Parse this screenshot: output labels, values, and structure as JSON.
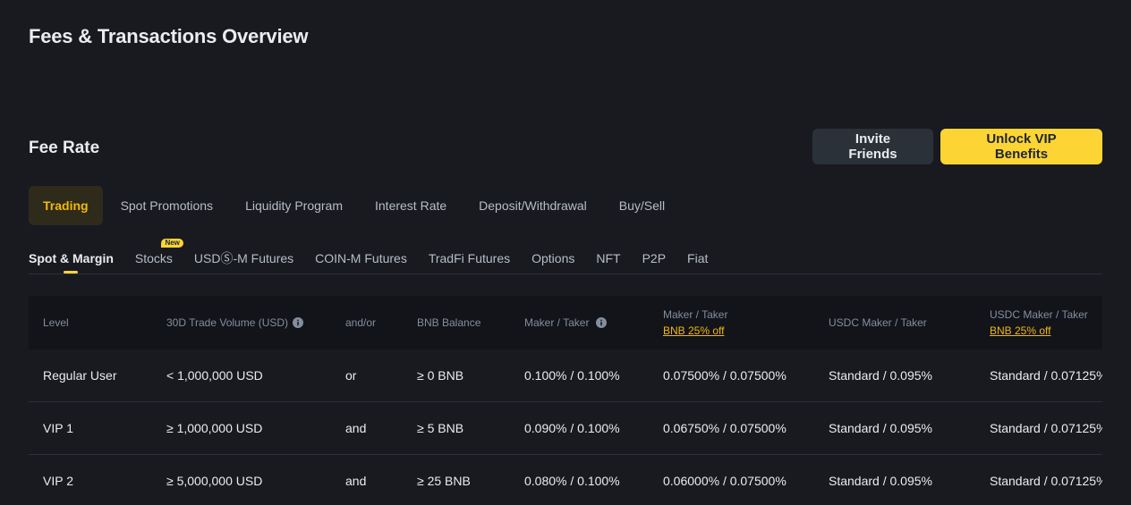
{
  "page": {
    "title": "Fees & Transactions Overview"
  },
  "fee_rate": {
    "title": "Fee Rate",
    "actions": {
      "invite_label": "Invite Friends",
      "vip_label": "Unlock VIP Benefits"
    }
  },
  "main_tabs": [
    "Trading",
    "Spot Promotions",
    "Liquidity Program",
    "Interest Rate",
    "Deposit/Withdrawal",
    "Buy/Sell"
  ],
  "sub_tabs": [
    "Spot & Margin",
    "Stocks",
    "USDⓈ-M Futures",
    "COIN-M Futures",
    "TradFi Futures",
    "Options",
    "NFT",
    "P2P",
    "Fiat"
  ],
  "sub_tab_badge": "New",
  "table": {
    "headers": {
      "level": "Level",
      "volume": "30D Trade Volume (USD)",
      "andor": "and/or",
      "bnb_balance": "BNB Balance",
      "maker_taker": "Maker / Taker",
      "maker_taker_bnb": "Maker / Taker",
      "maker_taker_bnb_link": "BNB 25% off",
      "usdc_maker_taker": "USDC Maker / Taker",
      "usdc_maker_taker_bnb": "USDC Maker / Taker",
      "usdc_maker_taker_bnb_link": "BNB 25% off"
    },
    "rows": [
      {
        "level": "Regular User",
        "volume": "< 1,000,000 USD",
        "andor": "or",
        "bnb_balance": "≥ 0 BNB",
        "maker_taker": "0.100% / 0.100%",
        "maker_taker_bnb": "0.07500% / 0.07500%",
        "usdc": "Standard / 0.095%",
        "usdc_bnb": "Standard / 0.07125%"
      },
      {
        "level": "VIP 1",
        "volume": "≥ 1,000,000 USD",
        "andor": "and",
        "bnb_balance": "≥ 5 BNB",
        "maker_taker": "0.090% / 0.100%",
        "maker_taker_bnb": "0.06750% / 0.07500%",
        "usdc": "Standard / 0.095%",
        "usdc_bnb": "Standard / 0.07125%"
      },
      {
        "level": "VIP 2",
        "volume": "≥ 5,000,000 USD",
        "andor": "and",
        "bnb_balance": "≥ 25 BNB",
        "maker_taker": "0.080% / 0.100%",
        "maker_taker_bnb": "0.06000% / 0.07500%",
        "usdc": "Standard / 0.095%",
        "usdc_bnb": "Standard / 0.07125%"
      }
    ]
  },
  "icons": {
    "info": "info-circle-icon"
  },
  "colors": {
    "background": "#181a20",
    "accent": "#fcd535",
    "active_tab_text": "#f0b90b",
    "secondary_button": "#2b3139",
    "table_header_bg": "#12141a"
  }
}
